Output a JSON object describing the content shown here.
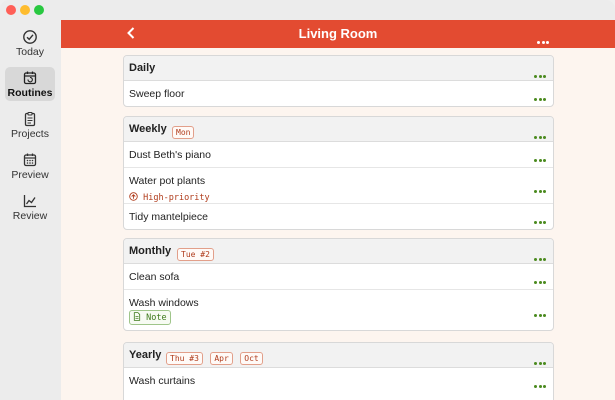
{
  "sidebar": {
    "items": [
      {
        "label": "Today",
        "icon": "check-circle-icon",
        "active": false
      },
      {
        "label": "Routines",
        "icon": "calendar-repeat-icon",
        "active": true
      },
      {
        "label": "Projects",
        "icon": "clipboard-icon",
        "active": false
      },
      {
        "label": "Preview",
        "icon": "calendar-grid-icon",
        "active": false
      },
      {
        "label": "Review",
        "icon": "line-chart-icon",
        "active": false
      }
    ]
  },
  "header": {
    "title": "Living Room",
    "back_icon": "chevron-left-icon",
    "more_icon": "ellipsis-icon"
  },
  "colors": {
    "accent": "#e34b31",
    "more_dots": "#4a8a1e",
    "badge_text": "#b03c1c",
    "note_green": "#3d7a1a"
  },
  "sections": [
    {
      "name": "Daily",
      "badges": [],
      "tasks": [
        {
          "label": "Sweep floor"
        }
      ]
    },
    {
      "name": "Weekly",
      "badges": [
        "Mon"
      ],
      "tasks": [
        {
          "label": "Dust Beth's piano"
        },
        {
          "label": "Water pot plants",
          "tag": "High-priority"
        },
        {
          "label": "Tidy mantelpiece"
        }
      ]
    },
    {
      "name": "Monthly",
      "badges": [
        "Tue #2"
      ],
      "tasks": [
        {
          "label": "Clean sofa"
        },
        {
          "label": "Wash windows",
          "note": "Note"
        }
      ]
    },
    {
      "name": "Yearly",
      "badges": [
        "Thu #3",
        "Apr",
        "Oct"
      ],
      "tasks": [
        {
          "label": "Wash curtains"
        }
      ]
    }
  ]
}
